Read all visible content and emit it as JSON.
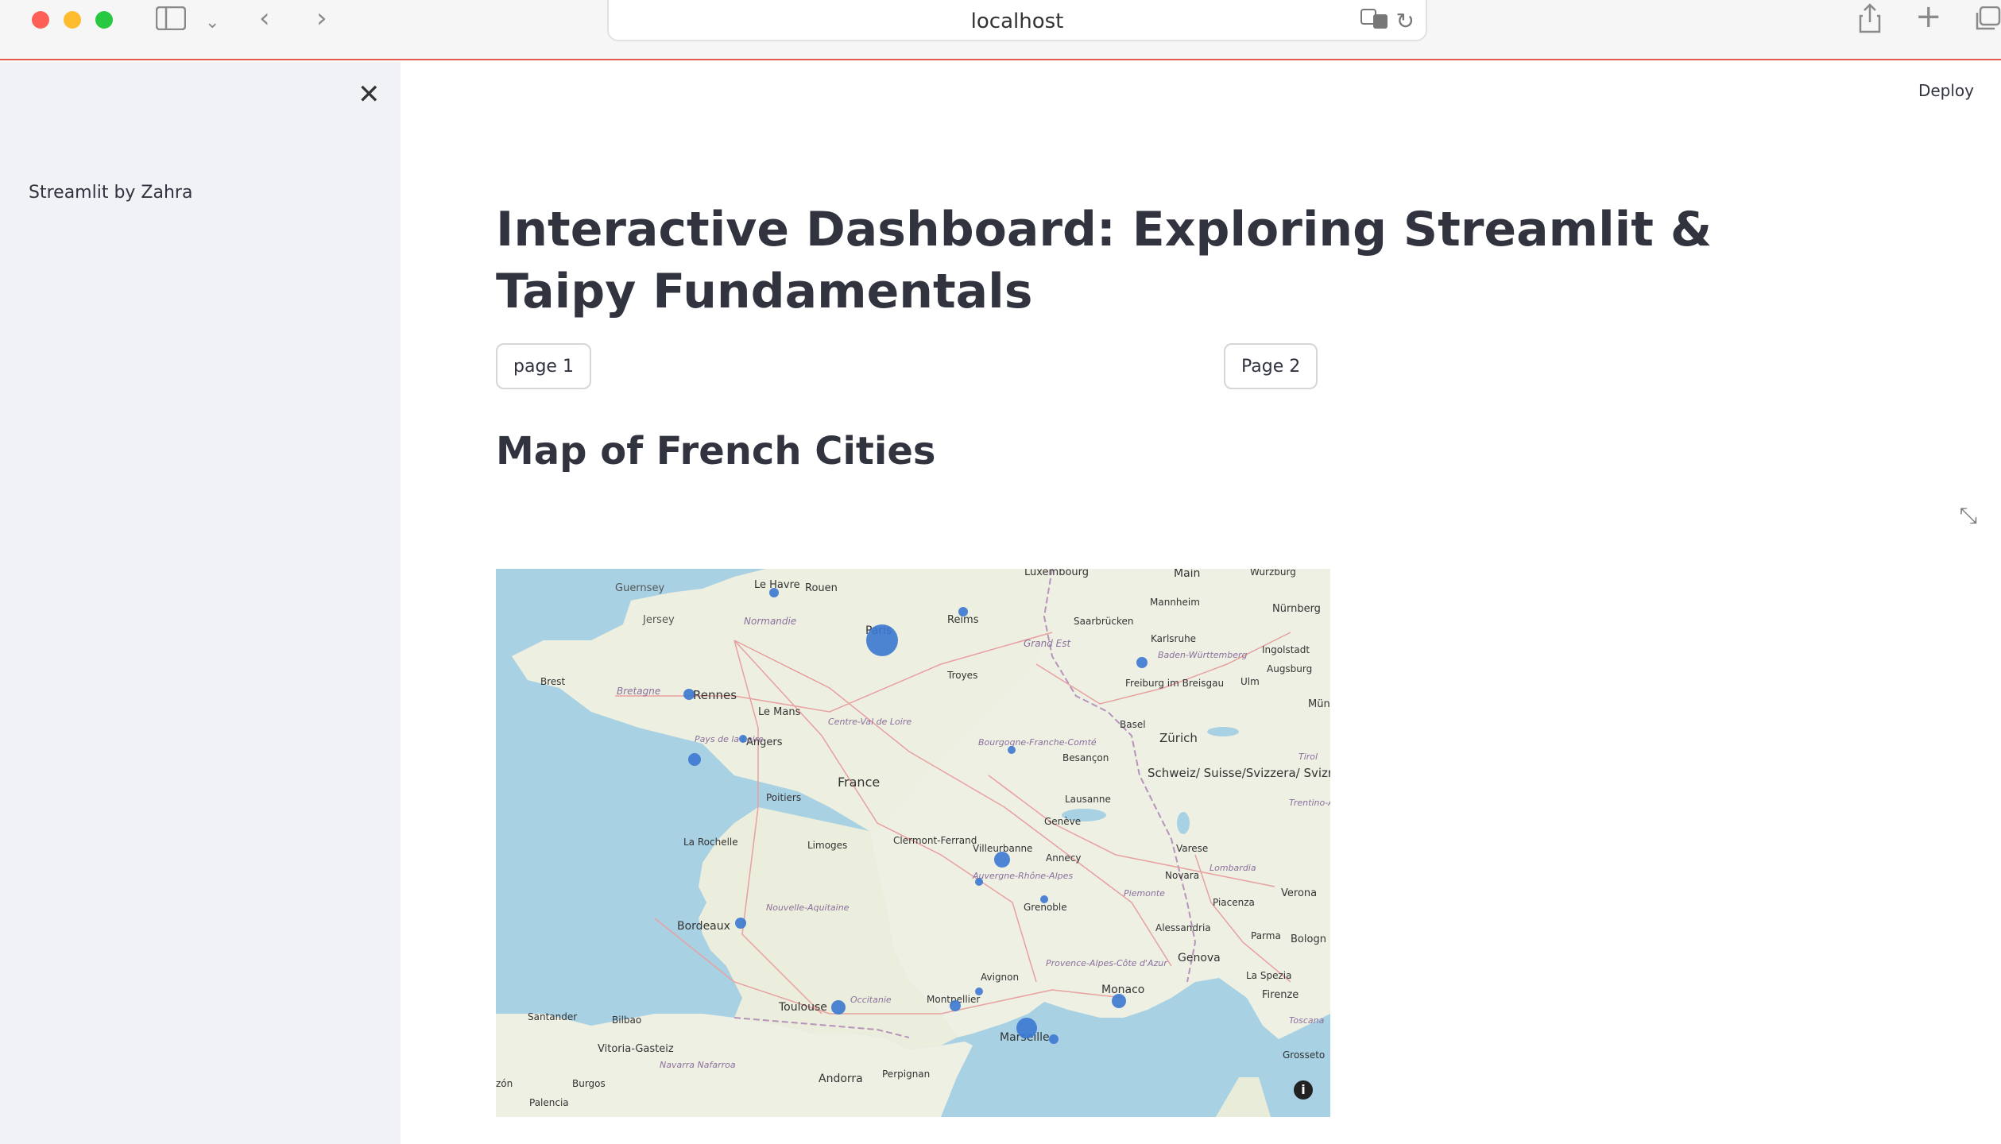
{
  "browser": {
    "url": "localhost"
  },
  "sidebar": {
    "text": "Streamlit by Zahra"
  },
  "header": {
    "deploy_label": "Deploy"
  },
  "main": {
    "title": "Interactive Dashboard: Exploring Streamlit & Taipy Fundamentals",
    "buttons": [
      {
        "label": "page 1"
      },
      {
        "label": "Page 2"
      }
    ],
    "subtitle": "Map of French Cities"
  },
  "map": {
    "place_labels": [
      "Guernsey",
      "Jersey",
      "Le Havre",
      "Rouen",
      "Normandie",
      "Paris",
      "Reims",
      "Luxembourg",
      "Main",
      "Würzburg",
      "Mannheim",
      "Nürnberg",
      "Saarbrücken",
      "Karlsruhe",
      "Grand Est",
      "Baden-Württemberg",
      "Ingolstadt",
      "Augsburg",
      "Ulm",
      "Münc",
      "Brest",
      "Bretagne",
      "Rennes",
      "Le Mans",
      "Troyes",
      "Freiburg im Breisgau",
      "Basel",
      "Zürich",
      "Centre-Val de Loire",
      "Angers",
      "Pays de la Loire",
      "Bourgogne-Franche-Comté",
      "Besançon",
      "Tirol",
      "France",
      "Poitiers",
      "Schweiz/ Suisse/Svizzera/ Svizra",
      "Lausanne",
      "Trentino-Alto Adige/Südtirol",
      "Genève",
      "La Rochelle",
      "Limoges",
      "Clermont-Ferrand",
      "Villeurbanne",
      "Annecy",
      "Varese",
      "Lombardia",
      "Auvergne-Rhône-Alpes",
      "Novara",
      "Verona",
      "Piemonte",
      "Grenoble",
      "Piacenza",
      "Nouvelle-Aquitaine",
      "Bordeaux",
      "Alessandria",
      "Parma",
      "Bologn",
      "Provence-Alpes-Côte d'Azur",
      "Genova",
      "Avignon",
      "La Spezia",
      "Monaco",
      "Firenze",
      "Montpellier",
      "Occitanie",
      "Toulouse",
      "Marseille",
      "Toscana",
      "Santander",
      "Bilbao",
      "Vitoria-Gasteiz",
      "Grosseto",
      "Navarra Nafarroa",
      "Andorra",
      "Perpignan",
      "Burgos",
      "Palencia",
      "zón"
    ]
  },
  "colors": {
    "accent_line": "#e55b4e",
    "sidebar_bg": "#f0f2f6",
    "text": "#31333f",
    "marker": "#3b78d0",
    "sea": "#a8d1e3",
    "land": "#eef0e4"
  },
  "icons": {
    "sidebar_toggle": "sidebar-icon",
    "back": "chevron-left-icon",
    "forward": "chevron-right-icon",
    "translate": "translate-icon",
    "reload": "reload-icon",
    "share": "share-icon",
    "new_tab": "plus-icon",
    "tabs": "tabs-icon",
    "close": "close-icon",
    "fullscreen": "expand-icon",
    "info": "info-icon"
  }
}
